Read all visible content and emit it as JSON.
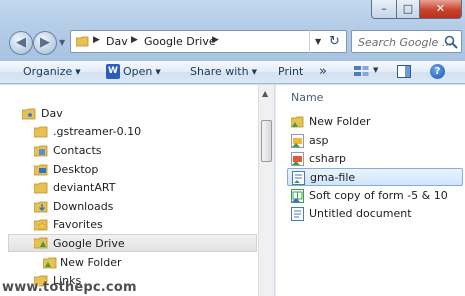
{
  "window": {
    "controls": {
      "minimize": "–",
      "maximize": "□",
      "close": "✕"
    }
  },
  "navigation": {
    "back_icon": "back-arrow",
    "forward_icon": "forward-arrow"
  },
  "address_bar": {
    "breadcrumbs": [
      "Dav",
      "Google Drive"
    ],
    "separator": "▶",
    "dropdown": "▼",
    "refresh": "↻"
  },
  "search": {
    "placeholder": "Search Google ..."
  },
  "toolbar": {
    "organize": "Organize",
    "open": "Open",
    "share_with": "Share with",
    "print": "Print",
    "more": "»",
    "open_icon_letter": "W",
    "help": "?"
  },
  "nav_pane": {
    "items": [
      {
        "label": "Dav",
        "icon": "user-folder-icon"
      },
      {
        "label": ".gstreamer-0.10",
        "icon": "folder-icon"
      },
      {
        "label": "Contacts",
        "icon": "contacts-folder-icon"
      },
      {
        "label": "Desktop",
        "icon": "desktop-folder-icon"
      },
      {
        "label": "deviantART",
        "icon": "folder-icon"
      },
      {
        "label": "Downloads",
        "icon": "downloads-folder-icon"
      },
      {
        "label": "Favorites",
        "icon": "favorites-folder-icon"
      },
      {
        "label": "Google Drive",
        "icon": "google-drive-folder-icon",
        "selected": true
      },
      {
        "label": "New Folder",
        "icon": "shared-folder-icon"
      },
      {
        "label": "Links",
        "icon": "links-folder-icon"
      }
    ]
  },
  "content": {
    "column_header": "Name",
    "files": [
      {
        "name": "New Folder",
        "icon": "shared-folder-icon"
      },
      {
        "name": "asp",
        "icon": "google-presentation-icon"
      },
      {
        "name": "csharp",
        "icon": "google-presentation-icon"
      },
      {
        "name": "gma-file",
        "icon": "google-doc-sync-icon",
        "selected": true
      },
      {
        "name": "Soft copy of form -5 & 10",
        "icon": "google-spreadsheet-icon"
      },
      {
        "name": "Untitled document",
        "icon": "google-doc-icon"
      }
    ]
  },
  "watermark": "www.tothepc.com",
  "colors": {
    "accent": "#2b5eb8",
    "folder": "#e7c153",
    "selection": "#cfe5fb"
  }
}
